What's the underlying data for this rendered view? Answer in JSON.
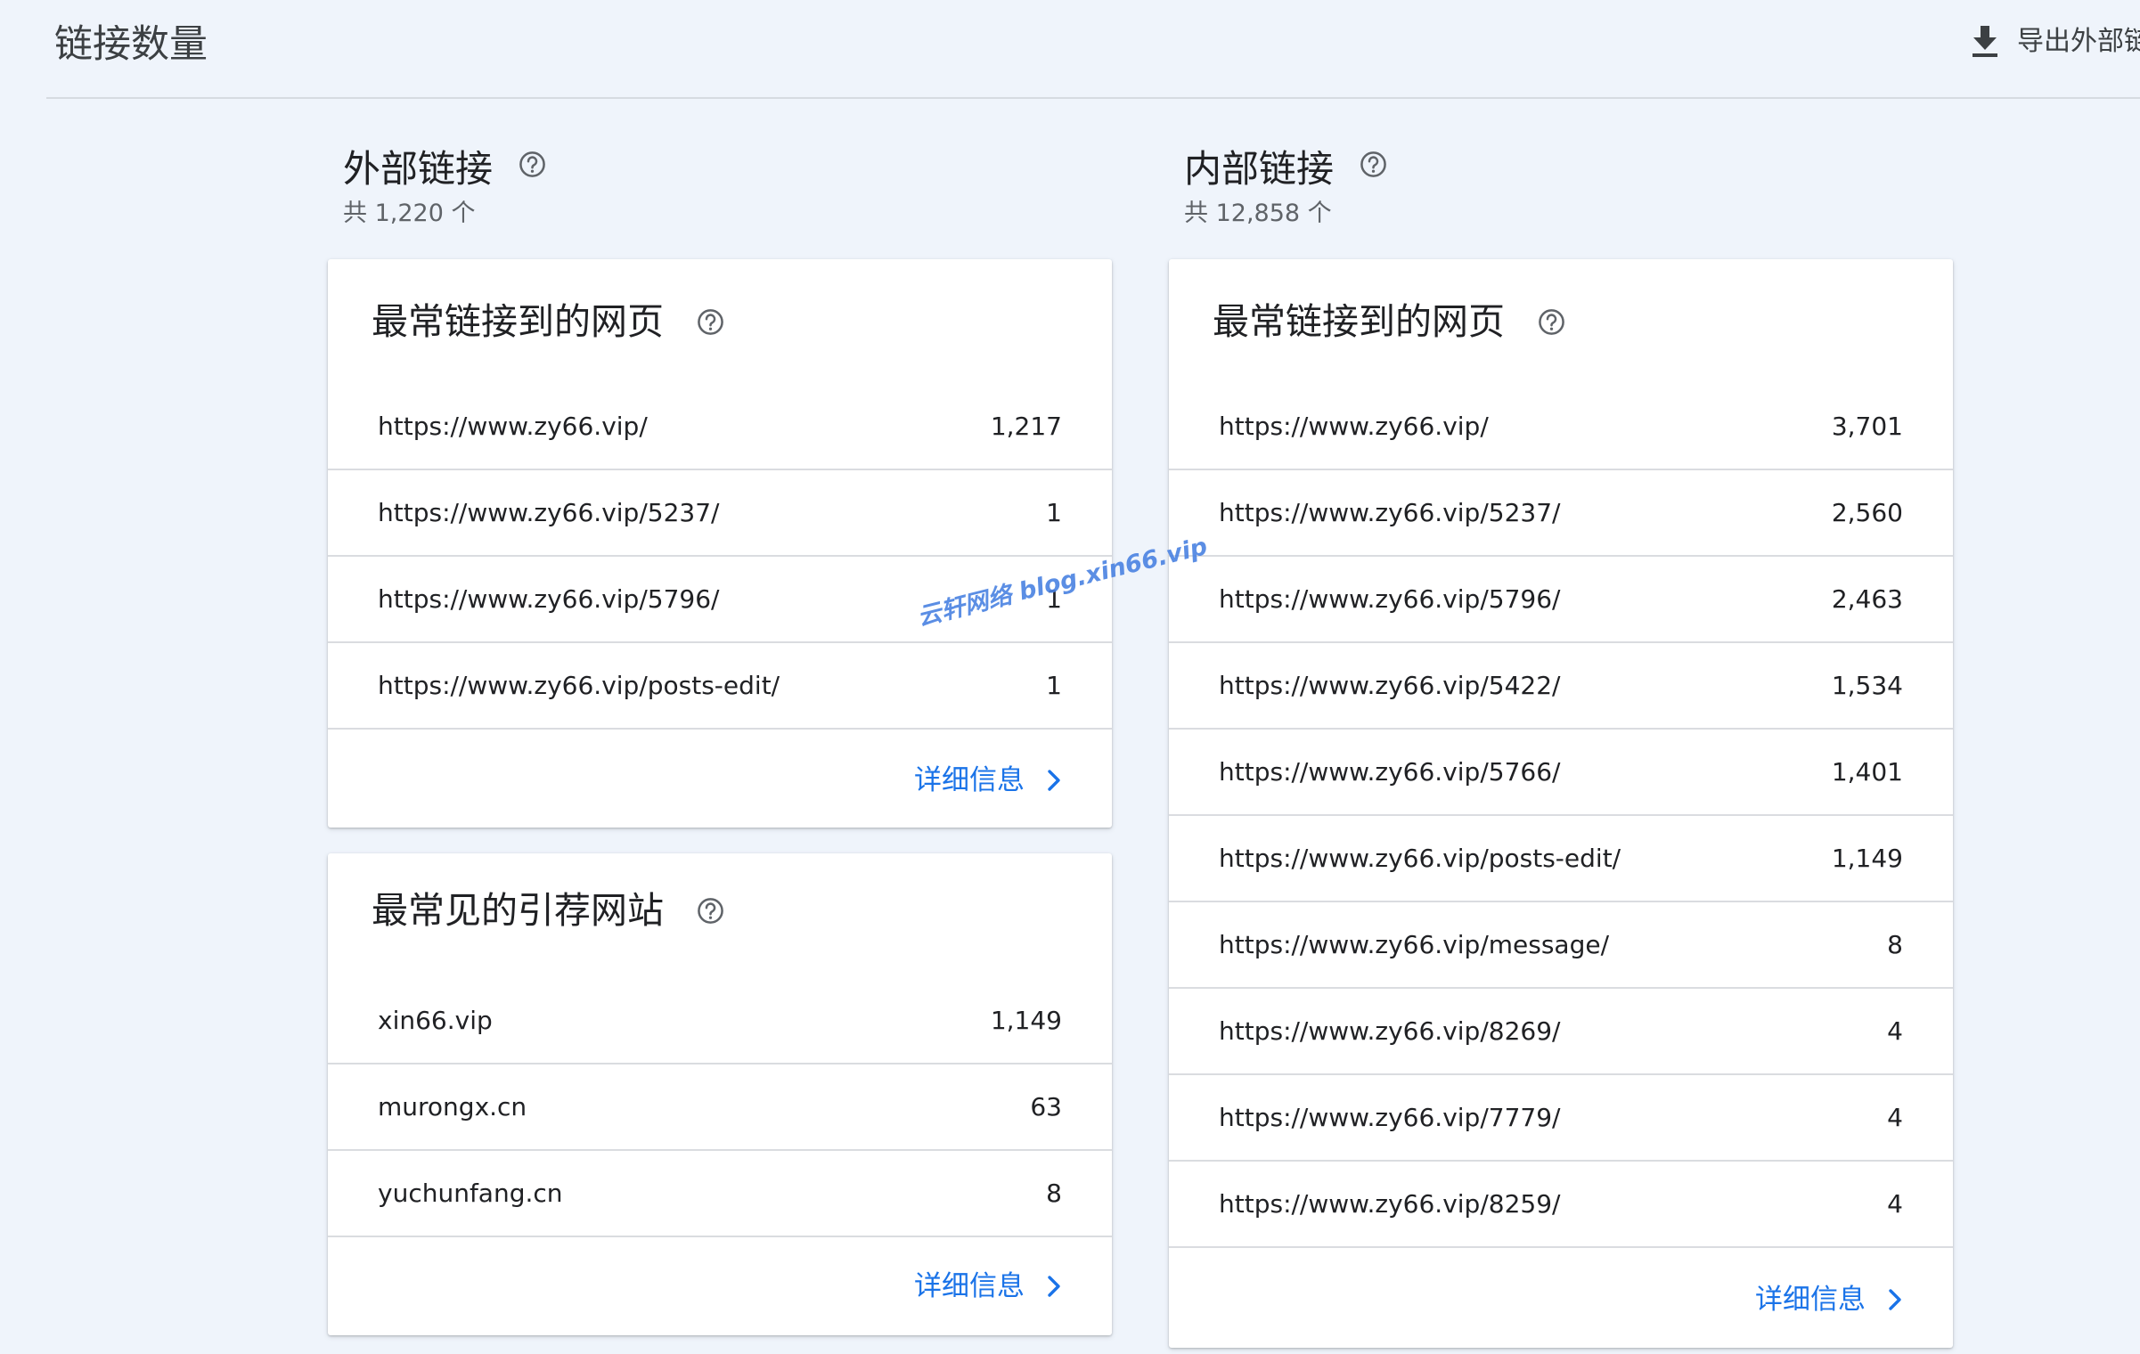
{
  "header": {
    "title": "链接数量",
    "export_label": "导出外部链接"
  },
  "external": {
    "title": "外部链接",
    "total": "共 1,220 个",
    "top_linked_pages": {
      "title": "最常链接到的网页",
      "rows": [
        {
          "url": "https://www.zy66.vip/",
          "count": "1,217"
        },
        {
          "url": "https://www.zy66.vip/5237/",
          "count": "1"
        },
        {
          "url": "https://www.zy66.vip/5796/",
          "count": "1"
        },
        {
          "url": "https://www.zy66.vip/posts-edit/",
          "count": "1"
        }
      ],
      "details_label": "详细信息"
    },
    "top_referring_sites": {
      "title": "最常见的引荐网站",
      "rows": [
        {
          "url": "xin66.vip",
          "count": "1,149"
        },
        {
          "url": "murongx.cn",
          "count": "63"
        },
        {
          "url": "yuchunfang.cn",
          "count": "8"
        }
      ],
      "details_label": "详细信息"
    }
  },
  "internal": {
    "title": "内部链接",
    "total": "共 12,858 个",
    "top_linked_pages": {
      "title": "最常链接到的网页",
      "rows": [
        {
          "url": "https://www.zy66.vip/",
          "count": "3,701"
        },
        {
          "url": "https://www.zy66.vip/5237/",
          "count": "2,560"
        },
        {
          "url": "https://www.zy66.vip/5796/",
          "count": "2,463"
        },
        {
          "url": "https://www.zy66.vip/5422/",
          "count": "1,534"
        },
        {
          "url": "https://www.zy66.vip/5766/",
          "count": "1,401"
        },
        {
          "url": "https://www.zy66.vip/posts-edit/",
          "count": "1,149"
        },
        {
          "url": "https://www.zy66.vip/message/",
          "count": "8"
        },
        {
          "url": "https://www.zy66.vip/8269/",
          "count": "4"
        },
        {
          "url": "https://www.zy66.vip/7779/",
          "count": "4"
        },
        {
          "url": "https://www.zy66.vip/8259/",
          "count": "4"
        }
      ],
      "details_label": "详细信息"
    }
  },
  "watermark": "云轩网络  blog.xin66.vip",
  "icons": {
    "export": "download-icon",
    "help": "help-circle-icon",
    "details": "chevron-right-icon"
  },
  "colors": {
    "background": "#eff4fb",
    "card": "#ffffff",
    "link": "#1a73e8",
    "text": "#202124",
    "muted": "#5f6368",
    "watermark": "#4a82e2"
  }
}
